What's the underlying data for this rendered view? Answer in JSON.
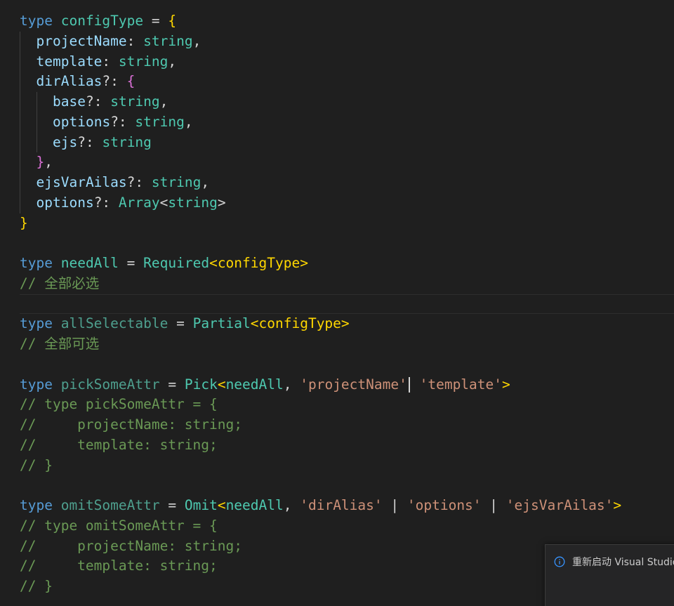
{
  "lines": [
    [
      {
        "t": "type",
        "c": "t-kw"
      },
      {
        "t": " "
      },
      {
        "t": "configType",
        "c": "t-type"
      },
      {
        "t": " = ",
        "c": "t-op"
      },
      {
        "t": "{",
        "c": "t-b1"
      }
    ],
    [
      {
        "t": "projectName",
        "c": "t-prop"
      },
      {
        "t": ": ",
        "c": "t-op"
      },
      {
        "t": "string",
        "c": "t-type"
      },
      {
        "t": ",",
        "c": "t-op"
      }
    ],
    [
      {
        "t": "template",
        "c": "t-prop"
      },
      {
        "t": ": ",
        "c": "t-op"
      },
      {
        "t": "string",
        "c": "t-type"
      },
      {
        "t": ",",
        "c": "t-op"
      }
    ],
    [
      {
        "t": "dirAlias",
        "c": "t-prop"
      },
      {
        "t": "?: ",
        "c": "t-op"
      },
      {
        "t": "{",
        "c": "t-b2"
      }
    ],
    [
      {
        "t": "base",
        "c": "t-prop"
      },
      {
        "t": "?: ",
        "c": "t-op"
      },
      {
        "t": "string",
        "c": "t-type"
      },
      {
        "t": ",",
        "c": "t-op"
      }
    ],
    [
      {
        "t": "options",
        "c": "t-prop"
      },
      {
        "t": "?: ",
        "c": "t-op"
      },
      {
        "t": "string",
        "c": "t-type"
      },
      {
        "t": ",",
        "c": "t-op"
      }
    ],
    [
      {
        "t": "ejs",
        "c": "t-prop"
      },
      {
        "t": "?: ",
        "c": "t-op"
      },
      {
        "t": "string",
        "c": "t-type"
      }
    ],
    [
      {
        "t": "}",
        "c": "t-b2"
      },
      {
        "t": ",",
        "c": "t-op"
      }
    ],
    [
      {
        "t": "ejsVarAilas",
        "c": "t-prop"
      },
      {
        "t": "?: ",
        "c": "t-op"
      },
      {
        "t": "string",
        "c": "t-type"
      },
      {
        "t": ",",
        "c": "t-op"
      }
    ],
    [
      {
        "t": "options",
        "c": "t-prop"
      },
      {
        "t": "?: ",
        "c": "t-op"
      },
      {
        "t": "Array",
        "c": "t-type"
      },
      {
        "t": "<",
        "c": "t-op"
      },
      {
        "t": "string",
        "c": "t-type"
      },
      {
        "t": ">",
        "c": "t-op"
      }
    ],
    [
      {
        "t": "}",
        "c": "t-b1"
      }
    ],
    [],
    [
      {
        "t": "type",
        "c": "t-kw"
      },
      {
        "t": " "
      },
      {
        "t": "needAll",
        "c": "t-type"
      },
      {
        "t": " = ",
        "c": "t-op"
      },
      {
        "t": "Required",
        "c": "t-type"
      },
      {
        "t": "<",
        "c": "t-b1"
      },
      {
        "t": "configType",
        "c": "t-b1"
      },
      {
        "t": ">",
        "c": "t-b1"
      }
    ],
    [
      {
        "t": "// 全部必选",
        "c": "t-com"
      }
    ],
    [],
    [
      {
        "t": "type",
        "c": "t-kw"
      },
      {
        "t": " "
      },
      {
        "t": "allSelectable",
        "c": "t-dim"
      },
      {
        "t": " = ",
        "c": "t-op"
      },
      {
        "t": "Partial",
        "c": "t-type"
      },
      {
        "t": "<",
        "c": "t-b1"
      },
      {
        "t": "configType",
        "c": "t-b1"
      },
      {
        "t": ">",
        "c": "t-b1"
      }
    ],
    [
      {
        "t": "// 全部可选",
        "c": "t-com"
      }
    ],
    [],
    [
      {
        "t": "type",
        "c": "t-kw"
      },
      {
        "t": " "
      },
      {
        "t": "pickSomeAttr",
        "c": "t-dim"
      },
      {
        "t": " = ",
        "c": "t-op"
      },
      {
        "t": "Pick",
        "c": "t-type"
      },
      {
        "t": "<",
        "c": "t-b1"
      },
      {
        "t": "needAll",
        "c": "t-type"
      },
      {
        "t": ", ",
        "c": "t-op"
      },
      {
        "t": "'projectName'",
        "c": "t-str"
      },
      {
        "t": "CURSOR"
      },
      {
        "t": " "
      },
      {
        "t": "'template'",
        "c": "t-str"
      },
      {
        "t": ">",
        "c": "t-b1"
      }
    ],
    [
      {
        "t": "// type pickSomeAttr = {",
        "c": "t-com"
      }
    ],
    [
      {
        "t": "//     projectName: string;",
        "c": "t-com"
      }
    ],
    [
      {
        "t": "//     template: string;",
        "c": "t-com"
      }
    ],
    [
      {
        "t": "// }",
        "c": "t-com"
      }
    ],
    [],
    [
      {
        "t": "type",
        "c": "t-kw"
      },
      {
        "t": " "
      },
      {
        "t": "omitSomeAttr",
        "c": "t-dim"
      },
      {
        "t": " = ",
        "c": "t-op"
      },
      {
        "t": "Omit",
        "c": "t-type"
      },
      {
        "t": "<",
        "c": "t-b1"
      },
      {
        "t": "needAll",
        "c": "t-type"
      },
      {
        "t": ", ",
        "c": "t-op"
      },
      {
        "t": "'dirAlias'",
        "c": "t-str"
      },
      {
        "t": " | ",
        "c": "t-op"
      },
      {
        "t": "'options'",
        "c": "t-str"
      },
      {
        "t": " | ",
        "c": "t-op"
      },
      {
        "t": "'ejsVarAilas'",
        "c": "t-str"
      },
      {
        "t": ">",
        "c": "t-b1"
      }
    ],
    [
      {
        "t": "// type omitSomeAttr = {",
        "c": "t-com"
      }
    ],
    [
      {
        "t": "//     projectName: string;",
        "c": "t-com"
      }
    ],
    [
      {
        "t": "//     template: string;",
        "c": "t-com"
      }
    ],
    [
      {
        "t": "// }",
        "c": "t-com"
      }
    ]
  ],
  "notification": {
    "message": "重新启动 Visual Studio Code",
    "icon": "info-icon",
    "accent": "#3794ff"
  }
}
